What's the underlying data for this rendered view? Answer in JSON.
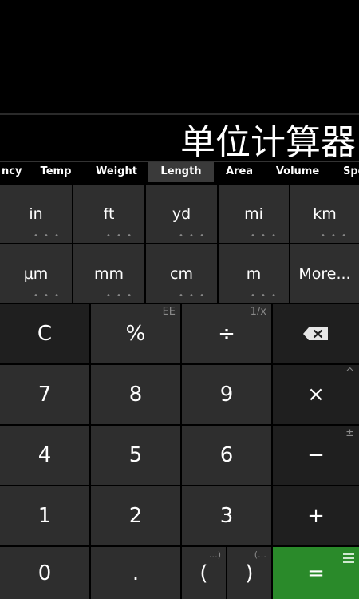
{
  "display": {
    "text": "单位计算器"
  },
  "tabs": [
    {
      "label": "ncy",
      "active": false
    },
    {
      "label": "Temp",
      "active": false
    },
    {
      "label": "Weight",
      "active": false
    },
    {
      "label": "Length",
      "active": true
    },
    {
      "label": "Area",
      "active": false
    },
    {
      "label": "Volume",
      "active": false
    },
    {
      "label": "Spe",
      "active": false
    }
  ],
  "units": {
    "row1": [
      "in",
      "ft",
      "yd",
      "mi",
      "km"
    ],
    "row2": [
      "µm",
      "mm",
      "cm",
      "m",
      "More..."
    ],
    "dots": "• • •"
  },
  "keys": {
    "clear": "C",
    "percent": "%",
    "percent_sec": "EE",
    "divide": "÷",
    "divide_sec": "1/x",
    "seven": "7",
    "eight": "8",
    "nine": "9",
    "multiply": "×",
    "multiply_sec": "^",
    "four": "4",
    "five": "5",
    "six": "6",
    "minus": "−",
    "minus_sec": "±",
    "one": "1",
    "two": "2",
    "three": "3",
    "plus": "+",
    "zero": "0",
    "dot": ".",
    "open_paren": "(",
    "open_paren_sec": "…)",
    "close_paren": ")",
    "close_paren_sec": "(…",
    "equals": "="
  },
  "colors": {
    "equals_bg": "#2a8a2a",
    "operator_bg": "#1f1f1f",
    "digit_bg": "#2e2e2e"
  }
}
